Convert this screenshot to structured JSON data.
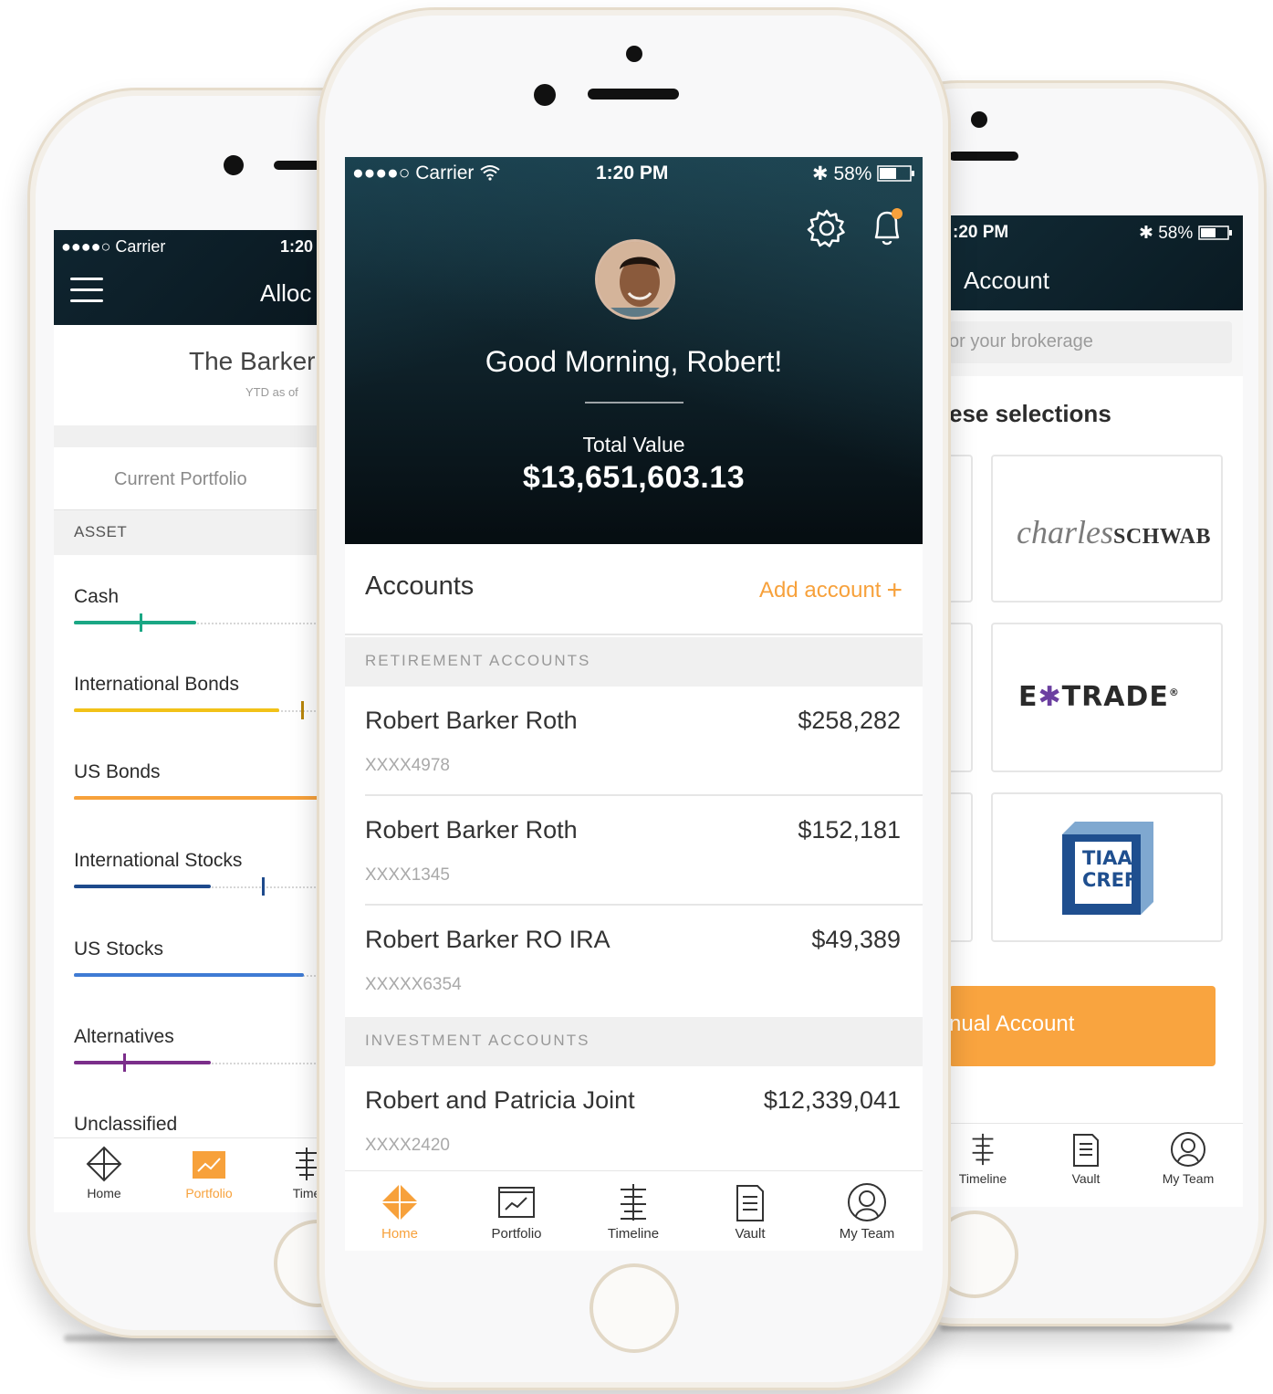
{
  "left_phone": {
    "status": {
      "carrier": "●●●●○ Carrier",
      "time": "1:20"
    },
    "title": "Alloc",
    "portfolio_name": "The Barker",
    "ytd_label": "YTD as of",
    "tab_label": "Current Portfolio",
    "asset_header": "ASSET",
    "assets": [
      {
        "name": "Cash",
        "color": "#1aa784",
        "fill": 0.5,
        "tick": 0.27
      },
      {
        "name": "International Bonds",
        "color": "#f2c218",
        "fill": 0.84,
        "tick": 0.93
      },
      {
        "name": "US Bonds",
        "color": "#f7a13b",
        "fill": 1.0,
        "tick": null
      },
      {
        "name": "International Stocks",
        "color": "#1e4a8c",
        "fill": 0.56,
        "tick": 0.77
      },
      {
        "name": "US Stocks",
        "color": "#3f7bd4",
        "fill": 0.94,
        "tick": null
      },
      {
        "name": "Alternatives",
        "color": "#7b2e8a",
        "fill": 0.56,
        "tick": 0.2
      },
      {
        "name": "Unclassified",
        "color": "#999999",
        "fill": 0,
        "tick": null
      }
    ],
    "tabs": [
      "Home",
      "Portfolio",
      "Time"
    ]
  },
  "center_phone": {
    "status": {
      "carrier": "●●●●○ Carrier",
      "time": "1:20 PM",
      "battery": "58%"
    },
    "greeting": "Good Morning, Robert!",
    "total_label": "Total Value",
    "total_value": "$13,651,603.13",
    "accounts_title": "Accounts",
    "add_account": "Add account",
    "add_plus": "+",
    "sections": [
      {
        "title": "RETIREMENT ACCOUNTS",
        "accounts": [
          {
            "name": "Robert Barker Roth",
            "value": "$258,282",
            "number": "XXXX4978"
          },
          {
            "name": "Robert Barker Roth",
            "value": "$152,181",
            "number": "XXXX1345"
          },
          {
            "name": "Robert Barker RO IRA",
            "value": "$49,389",
            "number": "XXXXX6354"
          }
        ]
      },
      {
        "title": "INVESTMENT ACCOUNTS",
        "accounts": [
          {
            "name": "Robert and Patricia Joint",
            "value": "$12,339,041",
            "number": "XXXX2420"
          }
        ]
      }
    ],
    "tabs": [
      "Home",
      "Portfolio",
      "Timeline",
      "Vault",
      "My Team"
    ],
    "accent": "#f7a13b"
  },
  "right_phone": {
    "status": {
      "time": ":20 PM",
      "battery": "58%"
    },
    "title": "Account",
    "search_placeholder": "or your brokerage",
    "selections_title": "ese selections",
    "brokers": {
      "schwab_script": "charles",
      "schwab_name": "SCHWAB",
      "etrade_e": "E",
      "etrade_star": "✱",
      "etrade_rest": "TRADE",
      "etrade_reg": "®",
      "tiaa_line1": "TIAA",
      "tiaa_line2": "CREF"
    },
    "manual_button": "nual Account",
    "tabs": [
      "Timeline",
      "Vault",
      "My Team"
    ]
  }
}
